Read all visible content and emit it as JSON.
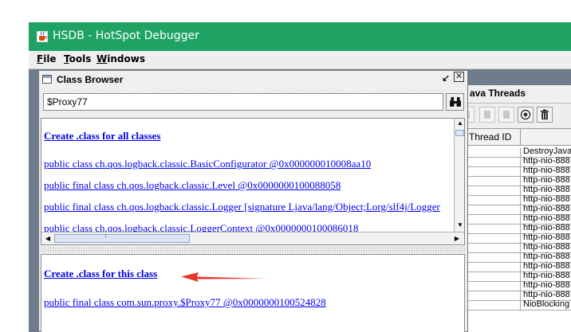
{
  "window": {
    "title": "HSDB - HotSpot Debugger",
    "icon": "java-cup-icon",
    "accent": "#1ea364"
  },
  "menu": [
    {
      "mnemonic": "F",
      "rest": "ile"
    },
    {
      "mnemonic": "T",
      "rest": "ools"
    },
    {
      "mnemonic": "W",
      "rest": "indows"
    }
  ],
  "java_threads": {
    "title": "ava Threads",
    "toolbar": [
      "disabled-icon",
      "disabled-icon",
      "disabled-icon",
      "inspect-icon",
      "trash-icon"
    ],
    "column_thread_id": "Thread ID",
    "rows": [
      "DestroyJava",
      "http-nio-888",
      "http-nio-888",
      "http-nio-888",
      "http-nio-888",
      "http-nio-888",
      "http-nio-888",
      "http-nio-888",
      "http-nio-888",
      "http-nio-888",
      "http-nio-888",
      "http-nio-888",
      "http-nio-888",
      "http-nio-888",
      "http-nio-888",
      "http-nio-888",
      "NioBlocking"
    ]
  },
  "class_browser": {
    "title": "Class Browser",
    "search_value": "$Proxy77",
    "find_icon": "binoculars-icon",
    "create_all": "Create .class for all classes",
    "classes": [
      "public class ch.qos.logback.classic.BasicConfigurator @0x000000010008aa10",
      "public final class ch.qos.logback.classic.Level @0x0000000100088058",
      "public final class ch.qos.logback.classic.Logger [signature Ljava/lang/Object;Lorg/slf4j/Logger",
      "public class ch.qos.logback.classic.LoggerContext @0x0000000100086018"
    ],
    "create_this": "Create .class for this class",
    "selected_class": "public final class com.sun.proxy.$Proxy77 @0x0000000100524828",
    "annotation_color": "#e8342a"
  }
}
